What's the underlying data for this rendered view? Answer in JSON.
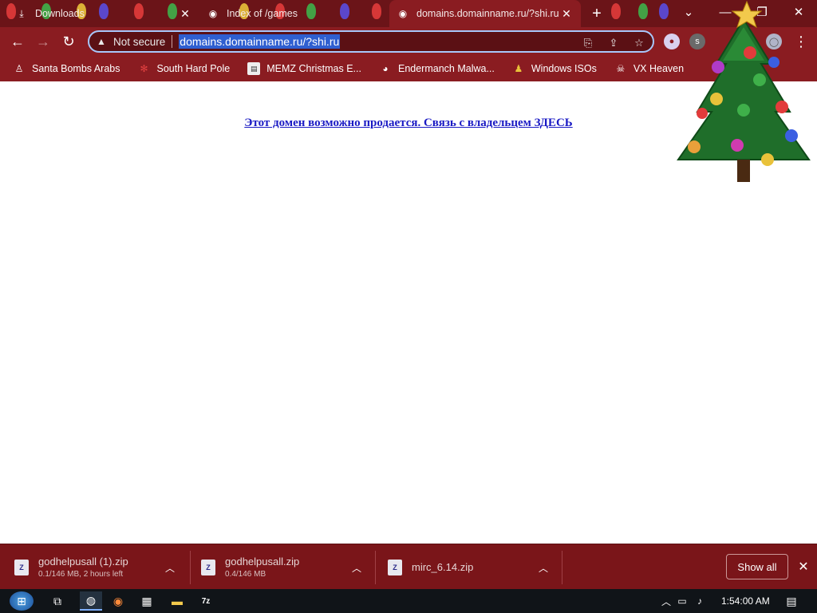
{
  "tabs": [
    {
      "title": "Downloads",
      "icon": "download-icon"
    },
    {
      "title": "Index of /games",
      "icon": "globe-icon"
    },
    {
      "title": "domains.domainname.ru/?shi.ru",
      "icon": "globe-icon",
      "active": true
    }
  ],
  "omnibox": {
    "security_label": "Not secure",
    "url": "domains.domainname.ru/?shi.ru"
  },
  "bookmarks": [
    {
      "label": "Santa Bombs Arabs",
      "icon": "figure-icon"
    },
    {
      "label": "South Hard Pole",
      "icon": "snowflake-icon"
    },
    {
      "label": "MEMZ Christmas E...",
      "icon": "page-icon"
    },
    {
      "label": "Endermanch Malwa...",
      "icon": "raccoon-icon"
    },
    {
      "label": "Windows ISOs",
      "icon": "figure-icon"
    },
    {
      "label": "VX Heaven",
      "icon": "skull-icon"
    }
  ],
  "page": {
    "link_text": "Этот домен возможно продается. Связь с владельцем ЗДЕСЬ"
  },
  "downloads": [
    {
      "name": "godhelpusall (1).zip",
      "status": "0.1/146 MB, 2 hours left"
    },
    {
      "name": "godhelpusall.zip",
      "status": "0.4/146 MB"
    },
    {
      "name": "mirc_6.14.zip",
      "status": ""
    }
  ],
  "shelf": {
    "show_all_label": "Show all"
  },
  "taskbar": {
    "time": "1:54:00 AM"
  },
  "colors": {
    "toolbar": "#8a1c21",
    "tabstrip": "#6b1418",
    "link": "#1a1ac4",
    "url_highlight": "#2f5fd0"
  }
}
